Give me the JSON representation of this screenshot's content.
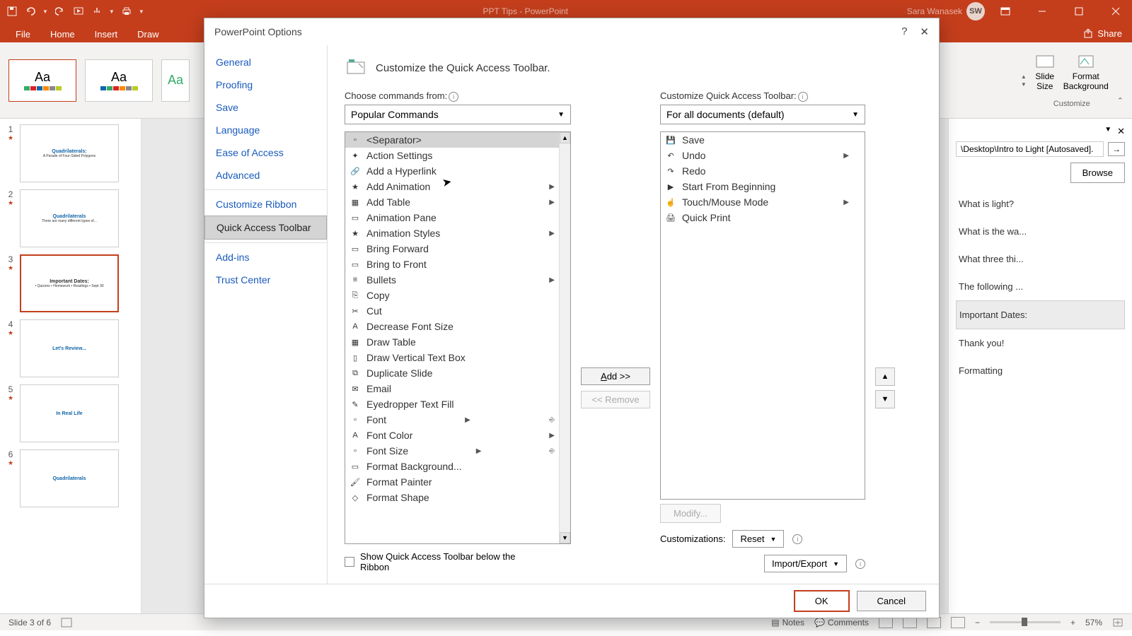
{
  "titlebar": {
    "app_title": "PPT Tips  -  PowerPoint",
    "user_name": "Sara Wanasek",
    "user_initials": "SW"
  },
  "ribbon": {
    "tabs": [
      "File",
      "Home",
      "Insert",
      "Draw"
    ],
    "share": "Share",
    "slide_size": "Slide\nSize",
    "format_bg": "Format\nBackground",
    "group_customize": "Customize"
  },
  "slides": [
    {
      "num": "1",
      "title": "Quadrilaterals:",
      "sub": "A Parade of Four-Sided Polygons"
    },
    {
      "num": "2",
      "title": "Quadrilaterals",
      "sub": "There are many different types of..."
    },
    {
      "num": "3",
      "title": "Important Dates:",
      "sub": "• Quizzes • Homework • Readings • Sept 30"
    },
    {
      "num": "4",
      "title": "Let's Review...",
      "sub": ""
    },
    {
      "num": "5",
      "title": "In Real Life",
      "sub": ""
    },
    {
      "num": "6",
      "title": "Quadrilaterals",
      "sub": ""
    }
  ],
  "right_panel": {
    "path": "\\Desktop\\Intro to Light [Autosaved].",
    "browse": "Browse",
    "items": [
      "What is light?",
      "What is the wa...",
      "What three thi...",
      "The following ...",
      "Important Dates:",
      "Thank you!",
      "Formatting"
    ]
  },
  "statusbar": {
    "slide_info": "Slide 3 of 6",
    "notes": "Notes",
    "comments": "Comments",
    "zoom": "57%"
  },
  "dialog": {
    "title": "PowerPoint Options",
    "sidebar": [
      "General",
      "Proofing",
      "Save",
      "Language",
      "Ease of Access",
      "Advanced",
      "Customize Ribbon",
      "Quick Access Toolbar",
      "Add-ins",
      "Trust Center"
    ],
    "header": "Customize the Quick Access Toolbar.",
    "choose_label": "Choose commands from:",
    "choose_value": "Popular Commands",
    "customize_label": "Customize Quick Access Toolbar:",
    "customize_value": "For all documents (default)",
    "left_list": [
      "<Separator>",
      "Action Settings",
      "Add a Hyperlink",
      "Add Animation",
      "Add Table",
      "Animation Pane",
      "Animation Styles",
      "Bring Forward",
      "Bring to Front",
      "Bullets",
      "Copy",
      "Cut",
      "Decrease Font Size",
      "Draw Table",
      "Draw Vertical Text Box",
      "Duplicate Slide",
      "Email",
      "Eyedropper Text Fill",
      "Font",
      "Font Color",
      "Font Size",
      "Format Background...",
      "Format Painter",
      "Format Shape"
    ],
    "right_list": [
      "Save",
      "Undo",
      "Redo",
      "Start From Beginning",
      "Touch/Mouse Mode",
      "Quick Print"
    ],
    "add_btn": "Add >>",
    "remove_btn": "<< Remove",
    "modify_btn": "Modify...",
    "show_below": "Show Quick Access Toolbar below the Ribbon",
    "customizations_label": "Customizations:",
    "reset": "Reset",
    "import_export": "Import/Export",
    "ok": "OK",
    "cancel": "Cancel"
  }
}
